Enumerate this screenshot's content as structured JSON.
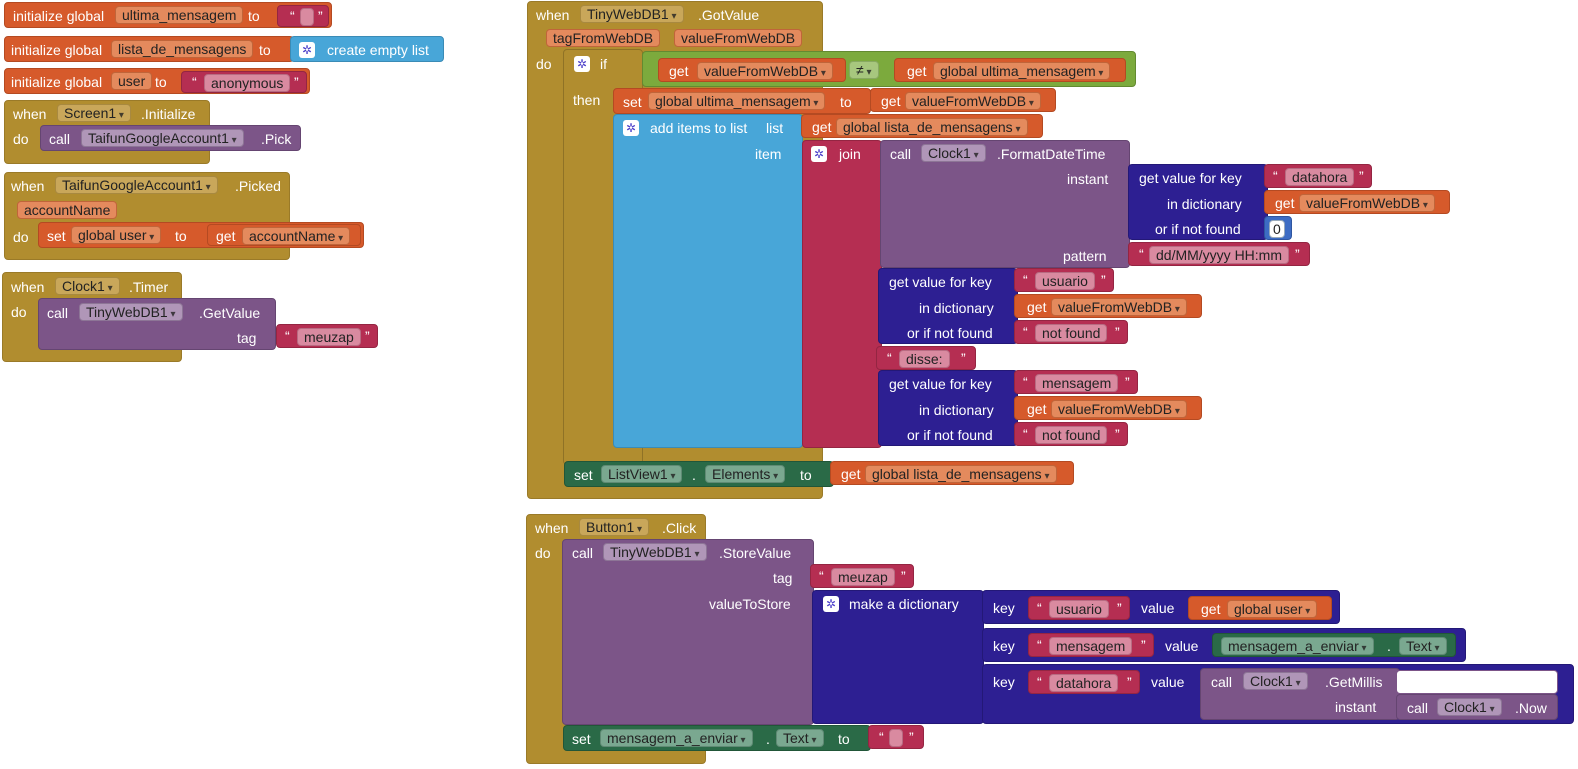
{
  "blocks": {
    "init1": {
      "initialize": "initialize global",
      "name": "ultima_mensagem",
      "to": "to",
      "quote_open": "“",
      "quote_close": "”"
    },
    "init2": {
      "initialize": "initialize global",
      "name": "lista_de_mensagens",
      "to": "to",
      "value": "create empty list"
    },
    "init3": {
      "initialize": "initialize global",
      "name": "user",
      "to": "to",
      "quote_open": "“",
      "value": "anonymous",
      "quote_close": "”"
    },
    "screen_init": {
      "when": "when",
      "component": "Screen1",
      "event": ".Initialize",
      "do": "do",
      "call": "call",
      "call_component": "TaifunGoogleAccount1",
      "method": ".Pick"
    },
    "picked": {
      "when": "when",
      "component": "TaifunGoogleAccount1",
      "event": ".Picked",
      "param": "accountName",
      "do": "do",
      "set": "set",
      "var": "global user",
      "to": "to",
      "get": "get",
      "get_var": "accountName"
    },
    "timer": {
      "when": "when",
      "component": "Clock1",
      "event": ".Timer",
      "do": "do",
      "call": "call",
      "call_component": "TinyWebDB1",
      "method": ".GetValue",
      "tag": "tag",
      "tag_value": "meuzap"
    },
    "gotvalue": {
      "when": "when",
      "component": "TinyWebDB1",
      "event": ".GotValue",
      "param1": "tagFromWebDB",
      "param2": "valueFromWebDB",
      "do": "do",
      "if": "if",
      "then": "then",
      "get": "get",
      "cond_left": "valueFromWebDB",
      "neq": "≠",
      "cond_right": "global ultima_mensagem",
      "set": "set",
      "set_var": "global ultima_mensagem",
      "to": "to",
      "set_value": "valueFromWebDB",
      "add_items": "add items to list",
      "list": "list",
      "list_value": "global lista_de_mensagens",
      "item": "item",
      "join": "join",
      "call": "call",
      "clock": "Clock1",
      "format": ".FormatDateTime",
      "instant": "instant",
      "get_value_for_key": "get value for key",
      "in_dictionary": "in dictionary",
      "or_if_not_found": "or if not found",
      "key_datahora": "datahora",
      "dict_var": "valueFromWebDB",
      "zero": "0",
      "pattern": "pattern",
      "pattern_value": "dd/MM/yyyy HH:mm",
      "key_usuario": "usuario",
      "not_found": "not found",
      "disse": "disse:",
      "key_mensagem": "mensagem",
      "set2": "set",
      "listview": "ListView1",
      "elements": "Elements",
      "to2": "to",
      "list_global": "global lista_de_mensagens"
    },
    "button": {
      "when": "when",
      "component": "Button1",
      "event": ".Click",
      "do": "do",
      "call": "call",
      "db": "TinyWebDB1",
      "store": ".StoreValue",
      "tag": "tag",
      "tag_value": "meuzap",
      "value_to_store": "valueToStore",
      "make_dict": "make a dictionary",
      "key": "key",
      "value": "value",
      "k1": "usuario",
      "v1": "global user",
      "k2": "mensagem",
      "v2_comp": "mensagem_a_enviar",
      "v2_prop": "Text",
      "k3": "datahora",
      "clock": "Clock1",
      "getmillis": ".GetMillis",
      "instant": "instant",
      "now": ".Now",
      "set": "set",
      "set_comp": "mensagem_a_enviar",
      "set_prop": "Text",
      "to": "to"
    }
  }
}
